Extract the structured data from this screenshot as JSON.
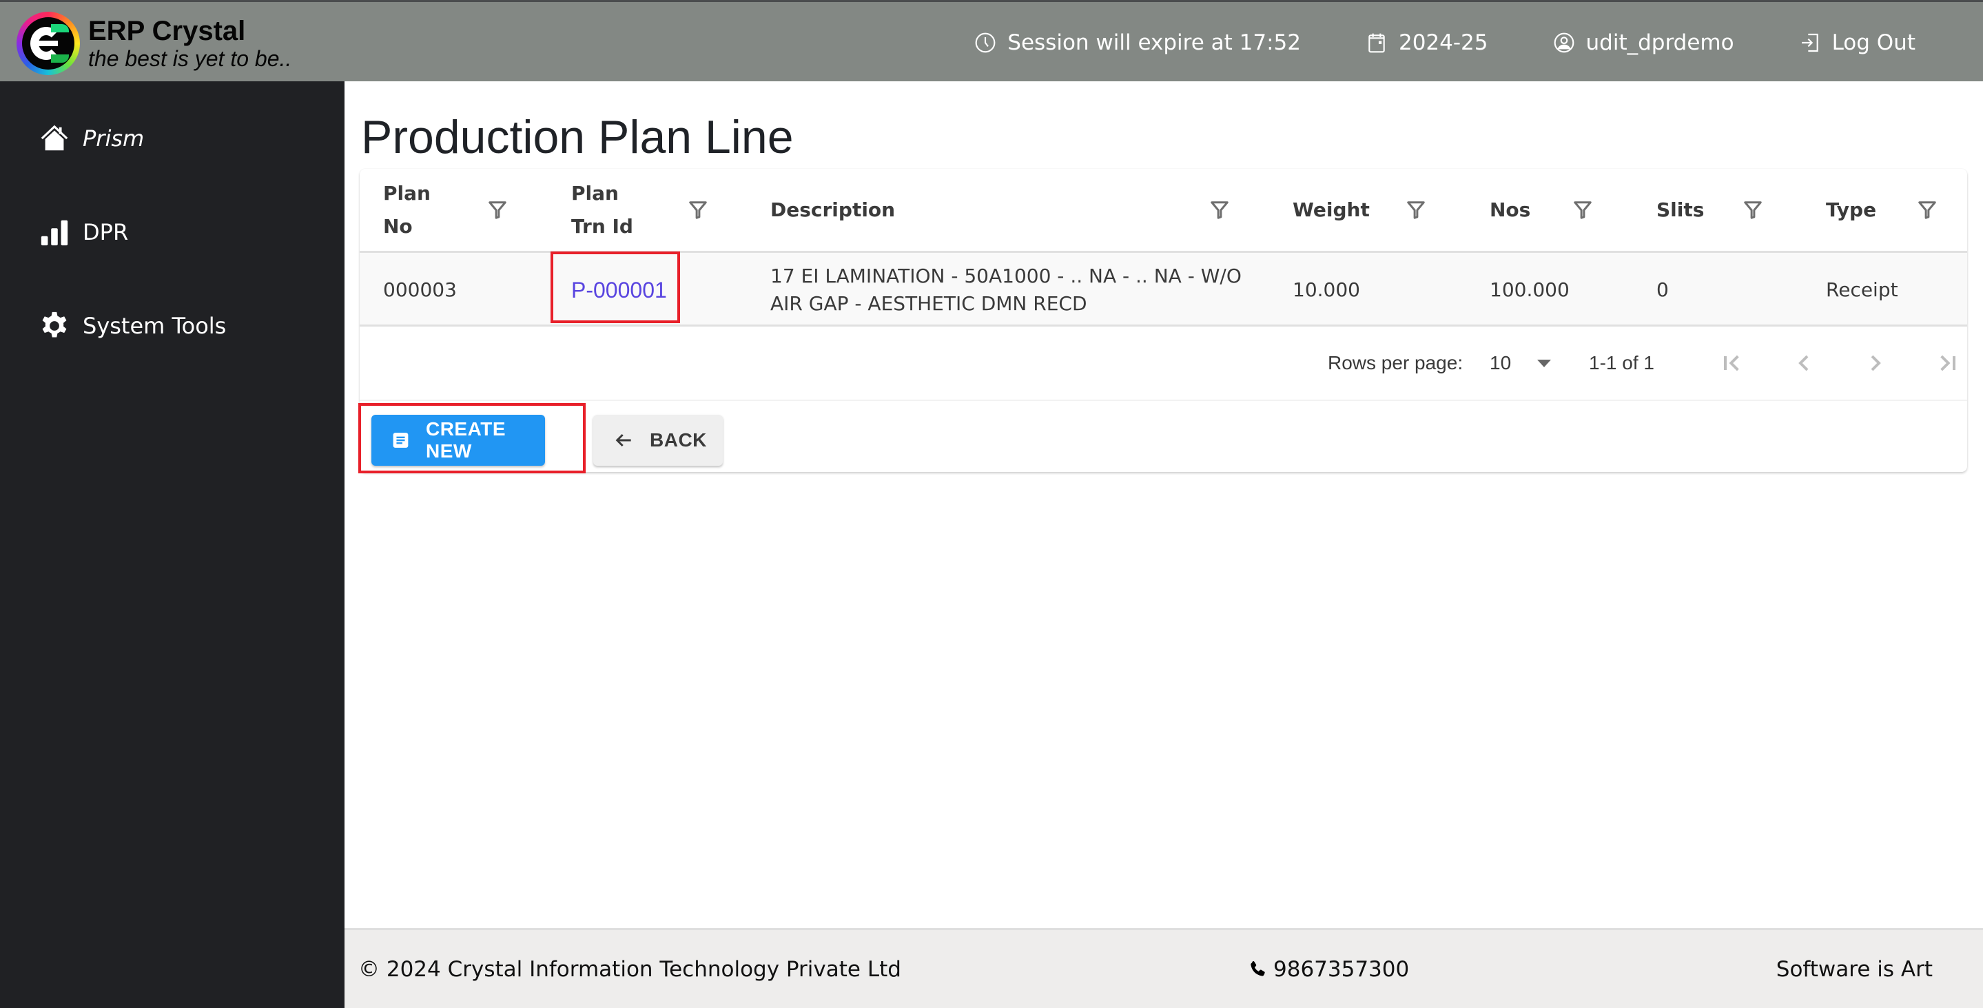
{
  "app": {
    "name": "ERP Crystal",
    "tagline": "the best is yet to be.."
  },
  "header": {
    "session": {
      "icon": "clock-icon",
      "text": "Session will expire at 17:52"
    },
    "fiscal_year": {
      "icon": "calendar-icon",
      "text": "2024-25"
    },
    "user": {
      "icon": "user-circle-icon",
      "text": "udit_dprdemo"
    },
    "logout": {
      "icon": "logout-icon",
      "text": "Log Out"
    }
  },
  "sidebar": {
    "items": [
      {
        "label": "Prism",
        "icon": "home-icon",
        "active": true
      },
      {
        "label": "DPR",
        "icon": "bar-chart-icon",
        "active": false
      },
      {
        "label": "System Tools",
        "icon": "gear-icon",
        "active": false
      }
    ]
  },
  "page": {
    "title": "Production Plan Line"
  },
  "table": {
    "columns": [
      {
        "key": "plan_no",
        "label_line1": "Plan",
        "label_line2": "No"
      },
      {
        "key": "plan_trn_id",
        "label_line1": "Plan",
        "label_line2": "Trn Id"
      },
      {
        "key": "description",
        "label_line1": "Description",
        "label_line2": ""
      },
      {
        "key": "weight",
        "label_line1": "Weight",
        "label_line2": ""
      },
      {
        "key": "nos",
        "label_line1": "Nos",
        "label_line2": ""
      },
      {
        "key": "slits",
        "label_line1": "Slits",
        "label_line2": ""
      },
      {
        "key": "type",
        "label_line1": "Type",
        "label_line2": ""
      }
    ],
    "rows": [
      {
        "plan_no": "000003",
        "plan_trn_id": "P-000001",
        "description": "17 EI LAMINATION - 50A1000 - .. NA - .. NA - W/O AIR GAP - AESTHETIC DMN RECD",
        "weight": "10.000",
        "nos": "100.000",
        "slits": "0",
        "type": "Receipt"
      }
    ],
    "pagination": {
      "rows_per_page_label": "Rows per page:",
      "rows_per_page_value": "10",
      "range_text": "1-1 of 1"
    }
  },
  "actions": {
    "create_new": "CREATE NEW",
    "back": "BACK"
  },
  "footer": {
    "copyright": "© 2024 Crystal Information Technology Private Ltd",
    "phone": "9867357300",
    "slogan": "Software is Art"
  },
  "colors": {
    "header_bg": "#838884",
    "sidebar_bg": "#202124",
    "primary": "#2196f3",
    "link": "#5945e0",
    "highlight": "#e8202a",
    "footer_bg": "#eeedec"
  }
}
